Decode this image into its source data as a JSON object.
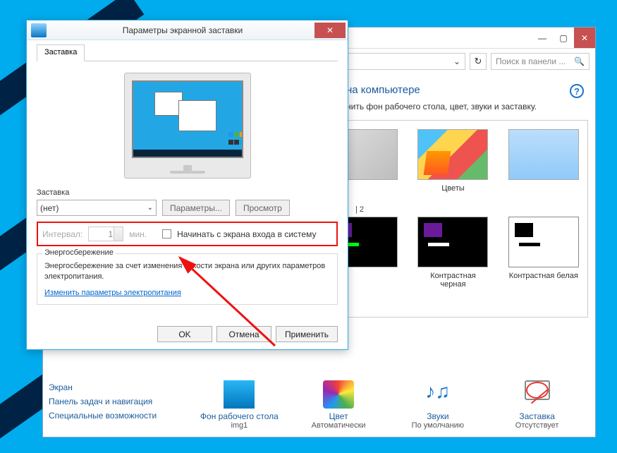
{
  "background_window": {
    "controls": {
      "minimize": "—",
      "maximize": "▢",
      "close": "✕"
    },
    "toolbar": {
      "breadcrumb_tail": "",
      "refresh": "↻",
      "search_placeholder": "Поиск в панели ...",
      "search_icon": "🔍"
    },
    "heading_partial": "на компьютере",
    "subtitle_partial": "нить фон рабочего стола, цвет, звуки и заставку.",
    "themes": {
      "row1": [
        {
          "label": ""
        },
        {
          "label": "Цветы"
        },
        {
          "label": ""
        }
      ],
      "region_label": "| 2",
      "row2": [
        {
          "label": "Контрастная черная"
        },
        {
          "label": "Контрастная белая"
        }
      ]
    },
    "sidebar_links": [
      "Экран",
      "Панель задач и навигация",
      "Специальные возможности"
    ],
    "quick_items": [
      {
        "title": "Фон рабочего стола",
        "sub": "img1"
      },
      {
        "title": "Цвет",
        "sub": "Автоматически"
      },
      {
        "title": "Звуки",
        "sub": "По умолчанию"
      },
      {
        "title": "Заставка",
        "sub": "Отсутствует"
      }
    ]
  },
  "dialog": {
    "title": "Параметры экранной заставки",
    "tab": "Заставка",
    "section_label": "Заставка",
    "combo_value": "(нет)",
    "params_btn": "Параметры...",
    "preview_btn": "Просмотр",
    "interval_label": "Интервал:",
    "interval_value": "1",
    "interval_unit": "мин.",
    "checkbox_label": "Начинать с экрана входа в систему",
    "energy_legend": "Энергосбережение",
    "energy_text": "Энергосбережение за счет изменения яркости экрана или других параметров электропитания.",
    "energy_link": "Изменить параметры электропитания",
    "ok": "OK",
    "cancel": "Отмена",
    "apply": "Применить"
  }
}
